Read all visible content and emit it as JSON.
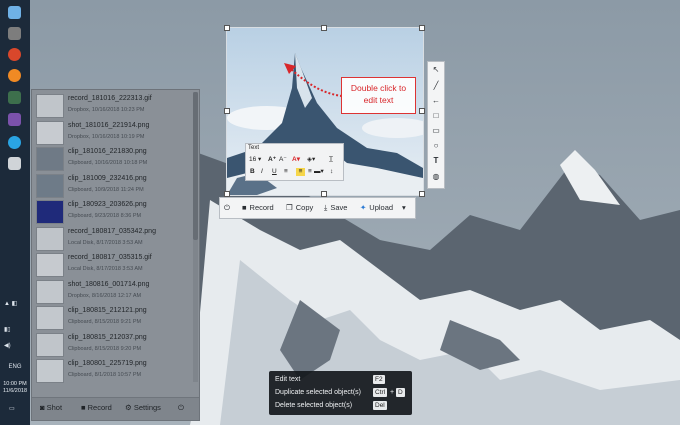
{
  "history": {
    "items": [
      {
        "name": "record_181016_222313.gif",
        "meta": "Dropbox, 10/16/2018 10:23 PM"
      },
      {
        "name": "shot_181016_221914.png",
        "meta": "Dropbox, 10/16/2018 10:19 PM"
      },
      {
        "name": "clip_181016_221830.png",
        "meta": "Clipboard, 10/16/2018 10:18 PM"
      },
      {
        "name": "clip_181009_232416.png",
        "meta": "Clipboard, 10/9/2018 11:24 PM"
      },
      {
        "name": "clip_180923_203626.png",
        "meta": "Clipboard, 9/23/2018 8:36 PM"
      },
      {
        "name": "record_180817_035342.png",
        "meta": "Local Disk, 8/17/2018 3:53 AM"
      },
      {
        "name": "record_180817_035315.gif",
        "meta": "Local Disk, 8/17/2018 3:53 AM"
      },
      {
        "name": "shot_180816_001714.png",
        "meta": "Dropbox, 8/16/2018 12:17 AM"
      },
      {
        "name": "clip_180815_212121.png",
        "meta": "Clipboard, 8/15/2018 9:21 PM"
      },
      {
        "name": "clip_180815_212037.png",
        "meta": "Clipboard, 8/15/2018 9:20 PM"
      },
      {
        "name": "clip_180801_225719.png",
        "meta": "Clipboard, 8/1/2018 10:57 PM"
      }
    ],
    "footer": {
      "shot": "Shot",
      "record": "Record",
      "settings": "Settings"
    }
  },
  "callout": {
    "line1": "Double click to",
    "line2": "edit text"
  },
  "text_toolbar": {
    "title": "Text",
    "font_size": "16"
  },
  "actions": {
    "record": "Record",
    "copy": "Copy",
    "save": "Save",
    "upload": "Upload"
  },
  "shortcuts": [
    {
      "label": "Edit text",
      "keys": [
        "F2"
      ]
    },
    {
      "label": "Duplicate selected object(s)",
      "keys": [
        "Ctrl",
        "D"
      ]
    },
    {
      "label": "Delete selected object(s)",
      "keys": [
        "Del"
      ]
    }
  ],
  "taskbar": {
    "lang": "ENG",
    "time": "10:00 PM",
    "date": "11/6/2018"
  },
  "colors": {
    "accent": "#d8262a",
    "taskbar": "#1c2a3a",
    "tooltip": "#14181c"
  }
}
